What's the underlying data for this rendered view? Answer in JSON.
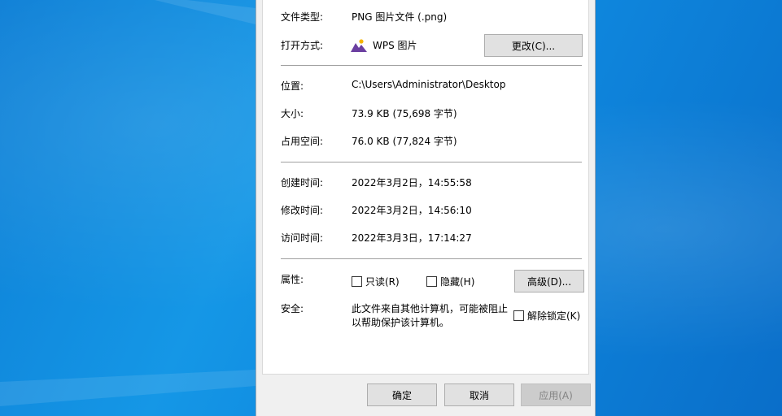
{
  "properties": {
    "file_type_label": "文件类型:",
    "file_type_value": "PNG 图片文件 (.png)",
    "open_with_label": "打开方式:",
    "open_with_value": "WPS 图片",
    "change_button": "更改(C)...",
    "location_label": "位置:",
    "location_value": "C:\\Users\\Administrator\\Desktop",
    "size_label": "大小:",
    "size_value": "73.9 KB (75,698 字节)",
    "size_on_disk_label": "占用空间:",
    "size_on_disk_value": "76.0 KB (77,824 字节)",
    "created_label": "创建时间:",
    "created_value": "2022年3月2日，14:55:58",
    "modified_label": "修改时间:",
    "modified_value": "2022年3月2日，14:56:10",
    "accessed_label": "访问时间:",
    "accessed_value": "2022年3月3日，17:14:27",
    "attributes_label": "属性:",
    "readonly_label": "只读(R)",
    "hidden_label": "隐藏(H)",
    "advanced_button": "高级(D)...",
    "security_label": "安全:",
    "security_text_line1": "此文件来自其他计算机，可能被阻止",
    "security_text_line2": "以帮助保护该计算机。",
    "unblock_label": "解除锁定(K)"
  },
  "footer": {
    "ok_button": "确定",
    "cancel_button": "取消",
    "apply_button": "应用(A)"
  },
  "colors": {
    "desktop": "#1597e6",
    "dialog_bg": "#f0f0f0",
    "wps_icon_purple": "#6b3fa0",
    "wps_icon_yellow": "#f5b400"
  }
}
